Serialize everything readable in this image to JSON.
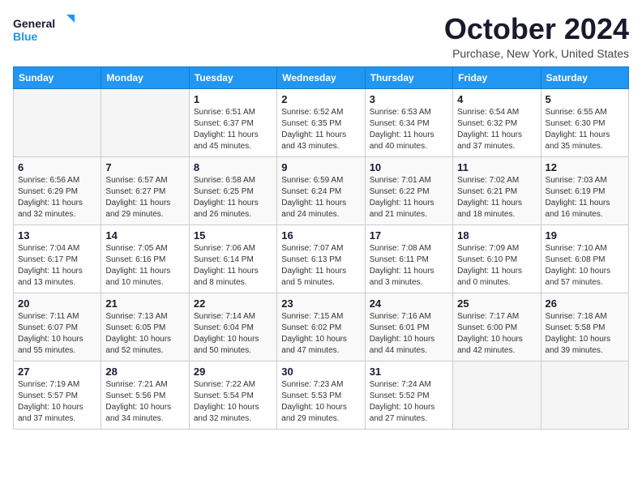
{
  "logo": {
    "line1": "General",
    "line2": "Blue"
  },
  "header": {
    "month": "October 2024",
    "location": "Purchase, New York, United States"
  },
  "weekdays": [
    "Sunday",
    "Monday",
    "Tuesday",
    "Wednesday",
    "Thursday",
    "Friday",
    "Saturday"
  ],
  "weeks": [
    [
      {
        "day": "",
        "sunrise": "",
        "sunset": "",
        "daylight": ""
      },
      {
        "day": "",
        "sunrise": "",
        "sunset": "",
        "daylight": ""
      },
      {
        "day": "1",
        "sunrise": "Sunrise: 6:51 AM",
        "sunset": "Sunset: 6:37 PM",
        "daylight": "Daylight: 11 hours and 45 minutes."
      },
      {
        "day": "2",
        "sunrise": "Sunrise: 6:52 AM",
        "sunset": "Sunset: 6:35 PM",
        "daylight": "Daylight: 11 hours and 43 minutes."
      },
      {
        "day": "3",
        "sunrise": "Sunrise: 6:53 AM",
        "sunset": "Sunset: 6:34 PM",
        "daylight": "Daylight: 11 hours and 40 minutes."
      },
      {
        "day": "4",
        "sunrise": "Sunrise: 6:54 AM",
        "sunset": "Sunset: 6:32 PM",
        "daylight": "Daylight: 11 hours and 37 minutes."
      },
      {
        "day": "5",
        "sunrise": "Sunrise: 6:55 AM",
        "sunset": "Sunset: 6:30 PM",
        "daylight": "Daylight: 11 hours and 35 minutes."
      }
    ],
    [
      {
        "day": "6",
        "sunrise": "Sunrise: 6:56 AM",
        "sunset": "Sunset: 6:29 PM",
        "daylight": "Daylight: 11 hours and 32 minutes."
      },
      {
        "day": "7",
        "sunrise": "Sunrise: 6:57 AM",
        "sunset": "Sunset: 6:27 PM",
        "daylight": "Daylight: 11 hours and 29 minutes."
      },
      {
        "day": "8",
        "sunrise": "Sunrise: 6:58 AM",
        "sunset": "Sunset: 6:25 PM",
        "daylight": "Daylight: 11 hours and 26 minutes."
      },
      {
        "day": "9",
        "sunrise": "Sunrise: 6:59 AM",
        "sunset": "Sunset: 6:24 PM",
        "daylight": "Daylight: 11 hours and 24 minutes."
      },
      {
        "day": "10",
        "sunrise": "Sunrise: 7:01 AM",
        "sunset": "Sunset: 6:22 PM",
        "daylight": "Daylight: 11 hours and 21 minutes."
      },
      {
        "day": "11",
        "sunrise": "Sunrise: 7:02 AM",
        "sunset": "Sunset: 6:21 PM",
        "daylight": "Daylight: 11 hours and 18 minutes."
      },
      {
        "day": "12",
        "sunrise": "Sunrise: 7:03 AM",
        "sunset": "Sunset: 6:19 PM",
        "daylight": "Daylight: 11 hours and 16 minutes."
      }
    ],
    [
      {
        "day": "13",
        "sunrise": "Sunrise: 7:04 AM",
        "sunset": "Sunset: 6:17 PM",
        "daylight": "Daylight: 11 hours and 13 minutes."
      },
      {
        "day": "14",
        "sunrise": "Sunrise: 7:05 AM",
        "sunset": "Sunset: 6:16 PM",
        "daylight": "Daylight: 11 hours and 10 minutes."
      },
      {
        "day": "15",
        "sunrise": "Sunrise: 7:06 AM",
        "sunset": "Sunset: 6:14 PM",
        "daylight": "Daylight: 11 hours and 8 minutes."
      },
      {
        "day": "16",
        "sunrise": "Sunrise: 7:07 AM",
        "sunset": "Sunset: 6:13 PM",
        "daylight": "Daylight: 11 hours and 5 minutes."
      },
      {
        "day": "17",
        "sunrise": "Sunrise: 7:08 AM",
        "sunset": "Sunset: 6:11 PM",
        "daylight": "Daylight: 11 hours and 3 minutes."
      },
      {
        "day": "18",
        "sunrise": "Sunrise: 7:09 AM",
        "sunset": "Sunset: 6:10 PM",
        "daylight": "Daylight: 11 hours and 0 minutes."
      },
      {
        "day": "19",
        "sunrise": "Sunrise: 7:10 AM",
        "sunset": "Sunset: 6:08 PM",
        "daylight": "Daylight: 10 hours and 57 minutes."
      }
    ],
    [
      {
        "day": "20",
        "sunrise": "Sunrise: 7:11 AM",
        "sunset": "Sunset: 6:07 PM",
        "daylight": "Daylight: 10 hours and 55 minutes."
      },
      {
        "day": "21",
        "sunrise": "Sunrise: 7:13 AM",
        "sunset": "Sunset: 6:05 PM",
        "daylight": "Daylight: 10 hours and 52 minutes."
      },
      {
        "day": "22",
        "sunrise": "Sunrise: 7:14 AM",
        "sunset": "Sunset: 6:04 PM",
        "daylight": "Daylight: 10 hours and 50 minutes."
      },
      {
        "day": "23",
        "sunrise": "Sunrise: 7:15 AM",
        "sunset": "Sunset: 6:02 PM",
        "daylight": "Daylight: 10 hours and 47 minutes."
      },
      {
        "day": "24",
        "sunrise": "Sunrise: 7:16 AM",
        "sunset": "Sunset: 6:01 PM",
        "daylight": "Daylight: 10 hours and 44 minutes."
      },
      {
        "day": "25",
        "sunrise": "Sunrise: 7:17 AM",
        "sunset": "Sunset: 6:00 PM",
        "daylight": "Daylight: 10 hours and 42 minutes."
      },
      {
        "day": "26",
        "sunrise": "Sunrise: 7:18 AM",
        "sunset": "Sunset: 5:58 PM",
        "daylight": "Daylight: 10 hours and 39 minutes."
      }
    ],
    [
      {
        "day": "27",
        "sunrise": "Sunrise: 7:19 AM",
        "sunset": "Sunset: 5:57 PM",
        "daylight": "Daylight: 10 hours and 37 minutes."
      },
      {
        "day": "28",
        "sunrise": "Sunrise: 7:21 AM",
        "sunset": "Sunset: 5:56 PM",
        "daylight": "Daylight: 10 hours and 34 minutes."
      },
      {
        "day": "29",
        "sunrise": "Sunrise: 7:22 AM",
        "sunset": "Sunset: 5:54 PM",
        "daylight": "Daylight: 10 hours and 32 minutes."
      },
      {
        "day": "30",
        "sunrise": "Sunrise: 7:23 AM",
        "sunset": "Sunset: 5:53 PM",
        "daylight": "Daylight: 10 hours and 29 minutes."
      },
      {
        "day": "31",
        "sunrise": "Sunrise: 7:24 AM",
        "sunset": "Sunset: 5:52 PM",
        "daylight": "Daylight: 10 hours and 27 minutes."
      },
      {
        "day": "",
        "sunrise": "",
        "sunset": "",
        "daylight": ""
      },
      {
        "day": "",
        "sunrise": "",
        "sunset": "",
        "daylight": ""
      }
    ]
  ]
}
